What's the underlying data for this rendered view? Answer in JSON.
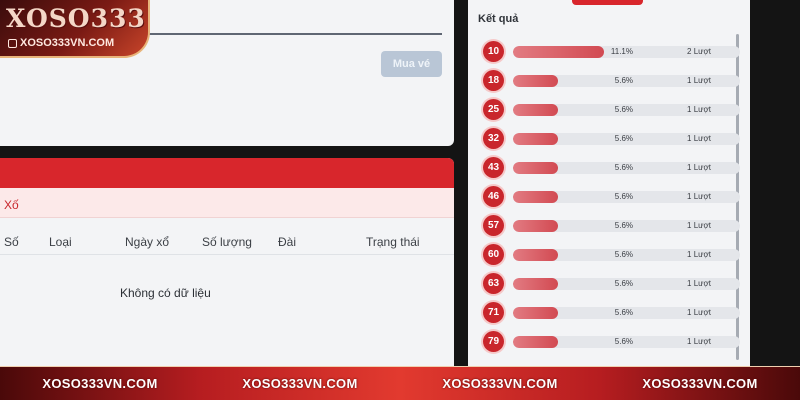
{
  "logo": {
    "title": "XOSO333",
    "subtitle": "XOSO333VN.COM"
  },
  "form": {
    "buy_label": "Mua vé"
  },
  "history": {
    "filter_label": "Xố",
    "columns": [
      "Số",
      "Loại",
      "Ngày xổ",
      "Số lượng",
      "Đài",
      "Trạng thái"
    ],
    "empty_text": "Không có dữ liệu"
  },
  "results": {
    "title": "Kết quả",
    "rows": [
      {
        "number": "10",
        "percent": "11.1%",
        "count": "2 Lượt",
        "fill": 0.4
      },
      {
        "number": "18",
        "percent": "5.6%",
        "count": "1 Lượt",
        "fill": 0.2
      },
      {
        "number": "25",
        "percent": "5.6%",
        "count": "1 Lượt",
        "fill": 0.2
      },
      {
        "number": "32",
        "percent": "5.6%",
        "count": "1 Lượt",
        "fill": 0.2
      },
      {
        "number": "43",
        "percent": "5.6%",
        "count": "1 Lượt",
        "fill": 0.2
      },
      {
        "number": "46",
        "percent": "5.6%",
        "count": "1 Lượt",
        "fill": 0.2
      },
      {
        "number": "57",
        "percent": "5.6%",
        "count": "1 Lượt",
        "fill": 0.2
      },
      {
        "number": "60",
        "percent": "5.6%",
        "count": "1 Lượt",
        "fill": 0.2
      },
      {
        "number": "63",
        "percent": "5.6%",
        "count": "1 Lượt",
        "fill": 0.2
      },
      {
        "number": "71",
        "percent": "5.6%",
        "count": "1 Lượt",
        "fill": 0.2
      },
      {
        "number": "79",
        "percent": "5.6%",
        "count": "1 Lượt",
        "fill": 0.2
      }
    ]
  },
  "banner": {
    "items": [
      "XOSO333VN.COM",
      "XOSO333VN.COM",
      "XOSO333VN.COM",
      "XOSO333VN.COM"
    ]
  },
  "colors": {
    "primary_red": "#d8262c",
    "bar_fill": "#d24a52",
    "button_disabled": "#b9c6d6"
  }
}
